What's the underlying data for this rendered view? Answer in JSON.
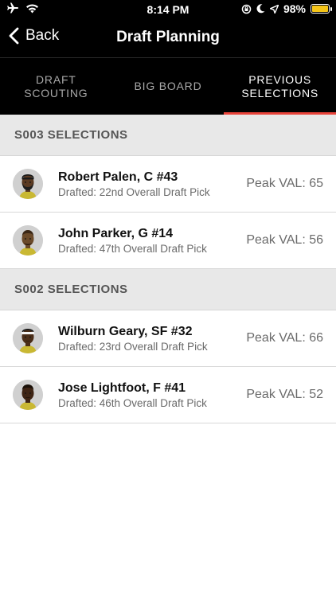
{
  "status_bar": {
    "time": "8:14 PM",
    "battery": "98%",
    "battery_level": 0.98,
    "battery_color": "#f5c518"
  },
  "nav": {
    "back_label": "Back",
    "title": "Draft Planning"
  },
  "tabs": [
    {
      "line1": "DRAFT",
      "line2": "SCOUTING",
      "active": false
    },
    {
      "line1": "BIG BOARD",
      "line2": "",
      "active": true
    },
    {
      "line1": "PREVIOUS",
      "line2": "SELECTIONS",
      "active": true
    }
  ],
  "accent_color": "#e8433a",
  "sections": [
    {
      "title": "S003 SELECTIONS",
      "players": [
        {
          "name": "Robert Palen, C #43",
          "drafted": "Drafted: 22nd Overall Draft Pick",
          "peak": "Peak VAL: 65",
          "headwear": "black-headband"
        },
        {
          "name": "John Parker, G #14",
          "drafted": "Drafted: 47th Overall Draft Pick",
          "peak": "Peak VAL: 56",
          "headwear": "none"
        }
      ]
    },
    {
      "title": "S002 SELECTIONS",
      "players": [
        {
          "name": "Wilburn Geary, SF #32",
          "drafted": "Drafted: 23rd Overall Draft Pick",
          "peak": "Peak VAL: 66",
          "headwear": "white-headband"
        },
        {
          "name": "Jose Lightfoot, F #41",
          "drafted": "Drafted: 46th Overall Draft Pick",
          "peak": "Peak VAL: 52",
          "headwear": "none"
        }
      ]
    }
  ]
}
